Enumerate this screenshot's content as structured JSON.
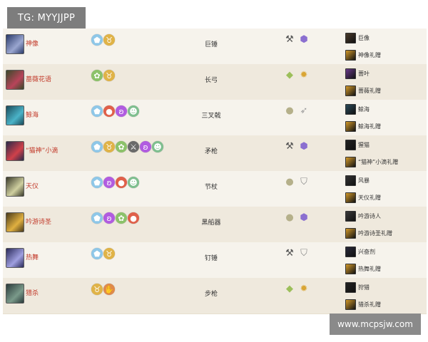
{
  "watermarks": {
    "top_left": "TG: MYYJJPP",
    "bottom_right": "www.mcpsjw.com"
  },
  "heroes": [
    {
      "name": "神像",
      "weapon": "巨锤",
      "icon_colors": [
        "#2a3a6a",
        "#9aa6d0"
      ],
      "tags": [
        {
          "icon": "shield-icon",
          "glyph": "⬟",
          "color": "#8ec7e8"
        },
        {
          "icon": "horns-icon",
          "glyph": "♉",
          "color": "#e0b347"
        }
      ],
      "ptype": [
        {
          "icon": "hammer-icon",
          "glyph": "⚒",
          "color": "#555555"
        },
        {
          "icon": "purple-crystal-icon",
          "glyph": "⬢",
          "color": "#8b6fd0"
        }
      ],
      "skins": [
        {
          "label": "巨像",
          "icon_color": "#4a3a2a"
        },
        {
          "label": "神像礼赠",
          "icon_color": "#d49a2a"
        }
      ]
    },
    {
      "name": "蔷薇花语",
      "weapon": "长弓",
      "icon_colors": [
        "#3a4a2a",
        "#b8445a"
      ],
      "tags": [
        {
          "icon": "leaf-cluster-icon",
          "glyph": "✿",
          "color": "#8cc26a"
        },
        {
          "icon": "horns-icon",
          "glyph": "♉",
          "color": "#e0b347"
        }
      ],
      "ptype": [
        {
          "icon": "green-drop-icon",
          "glyph": "◆",
          "color": "#9cbf5a"
        },
        {
          "icon": "gold-star-icon",
          "glyph": "✹",
          "color": "#d9a534"
        }
      ],
      "skins": [
        {
          "label": "蔷叶",
          "icon_color": "#6a3a8a"
        },
        {
          "label": "蔷薇礼赠",
          "icon_color": "#d49a2a"
        }
      ]
    },
    {
      "name": "鲸海",
      "weapon": "三叉戟",
      "icon_colors": [
        "#1a4a5a",
        "#4ab3c8"
      ],
      "tags": [
        {
          "icon": "shield-icon",
          "glyph": "⬟",
          "color": "#8ec7e8"
        },
        {
          "icon": "apple-icon",
          "glyph": "●",
          "color": "#e0604a"
        },
        {
          "icon": "butterfly-icon",
          "glyph": "ʚ",
          "color": "#b15ce0"
        },
        {
          "icon": "skull-icon",
          "glyph": "☻",
          "color": "#7fbf8f"
        }
      ],
      "ptype": [
        {
          "icon": "khaki-orb-icon",
          "glyph": "●",
          "color": "#b5b08a"
        },
        {
          "icon": "feather-icon",
          "glyph": "➶",
          "color": "#9a9a9a"
        }
      ],
      "skins": [
        {
          "label": "鲸海",
          "icon_color": "#2a4a5a"
        },
        {
          "label": "鲸海礼赠",
          "icon_color": "#d49a2a"
        }
      ]
    },
    {
      "name": "“猫神”小滴",
      "weapon": "矛枪",
      "icon_colors": [
        "#2a2a4a",
        "#d0404a"
      ],
      "tags": [
        {
          "icon": "shield-icon",
          "glyph": "⬟",
          "color": "#8ec7e8"
        },
        {
          "icon": "horns-icon",
          "glyph": "♉",
          "color": "#e0b347"
        },
        {
          "icon": "leaf-cluster-icon",
          "glyph": "✿",
          "color": "#8cc26a"
        },
        {
          "icon": "crossed-swords-icon",
          "glyph": "⚔",
          "color": "#6a6a6a"
        },
        {
          "icon": "butterfly-icon",
          "glyph": "ʚ",
          "color": "#b15ce0"
        },
        {
          "icon": "skull-icon",
          "glyph": "☻",
          "color": "#7fbf8f"
        }
      ],
      "ptype": [
        {
          "icon": "hammer-icon",
          "glyph": "⚒",
          "color": "#555555"
        },
        {
          "icon": "purple-crystal-icon",
          "glyph": "⬢",
          "color": "#8b6fd0"
        }
      ],
      "skins": [
        {
          "label": "猩猫",
          "icon_color": "#222222"
        },
        {
          "label": "“猫神”小滴礼赠",
          "icon_color": "#d49a2a"
        }
      ]
    },
    {
      "name": "天仪",
      "weapon": "节杖",
      "icon_colors": [
        "#3a3a2a",
        "#d0d0a0"
      ],
      "tags": [
        {
          "icon": "shield-icon",
          "glyph": "⬟",
          "color": "#8ec7e8"
        },
        {
          "icon": "butterfly-icon",
          "glyph": "ʚ",
          "color": "#b15ce0"
        },
        {
          "icon": "apple-icon",
          "glyph": "●",
          "color": "#e0604a"
        },
        {
          "icon": "skull-icon",
          "glyph": "☻",
          "color": "#7fbf8f"
        }
      ],
      "ptype": [
        {
          "icon": "khaki-orb-icon",
          "glyph": "●",
          "color": "#b5b08a"
        },
        {
          "icon": "grey-shield-icon",
          "glyph": "⛉",
          "color": "#8a8a8a"
        }
      ],
      "skins": [
        {
          "label": "风暴",
          "icon_color": "#333333"
        },
        {
          "label": "天仪礼赠",
          "icon_color": "#d49a2a"
        }
      ]
    },
    {
      "name": "吟游诗圣",
      "weapon": "黑船器",
      "icon_colors": [
        "#4a3a1a",
        "#e0b040"
      ],
      "tags": [
        {
          "icon": "shield-icon",
          "glyph": "⬟",
          "color": "#8ec7e8"
        },
        {
          "icon": "butterfly-icon",
          "glyph": "ʚ",
          "color": "#b15ce0"
        },
        {
          "icon": "leaf-cluster-icon",
          "glyph": "✿",
          "color": "#8cc26a"
        },
        {
          "icon": "apple-icon",
          "glyph": "●",
          "color": "#e0604a"
        }
      ],
      "ptype": [
        {
          "icon": "khaki-orb-icon",
          "glyph": "●",
          "color": "#b5b08a"
        },
        {
          "icon": "purple-crystal-icon",
          "glyph": "⬢",
          "color": "#8b6fd0"
        }
      ],
      "skins": [
        {
          "label": "吟游诗人",
          "icon_color": "#3a3a3a"
        },
        {
          "label": "吟游诗圣礼赠",
          "icon_color": "#d49a2a"
        }
      ]
    },
    {
      "name": "热舞",
      "weapon": "钉锤",
      "icon_colors": [
        "#2a2a5a",
        "#a0a0e0"
      ],
      "tags": [
        {
          "icon": "shield-icon",
          "glyph": "⬟",
          "color": "#8ec7e8"
        },
        {
          "icon": "horns-icon",
          "glyph": "♉",
          "color": "#e0b347"
        }
      ],
      "ptype": [
        {
          "icon": "hammer-icon",
          "glyph": "⚒",
          "color": "#555555"
        },
        {
          "icon": "grey-shield-icon",
          "glyph": "⛉",
          "color": "#8a8a8a"
        }
      ],
      "skins": [
        {
          "label": "兴奋剂",
          "icon_color": "#2a2a3a"
        },
        {
          "label": "热舞礼赠",
          "icon_color": "#d49a2a"
        }
      ]
    },
    {
      "name": "猎杀",
      "weapon": "步枪",
      "icon_colors": [
        "#2a3a3a",
        "#7a9a8a"
      ],
      "tags": [
        {
          "icon": "horns-icon",
          "glyph": "♉",
          "color": "#e0b347"
        },
        {
          "icon": "hand-icon",
          "glyph": "✋",
          "color": "#e08a4a"
        }
      ],
      "ptype": [
        {
          "icon": "green-drop-icon",
          "glyph": "◆",
          "color": "#9cbf5a"
        },
        {
          "icon": "gold-star-icon",
          "glyph": "✹",
          "color": "#d9a534"
        }
      ],
      "skins": [
        {
          "label": "狩猎",
          "icon_color": "#222222"
        },
        {
          "label": "猎杀礼赠",
          "icon_color": "#d49a2a"
        }
      ]
    }
  ]
}
